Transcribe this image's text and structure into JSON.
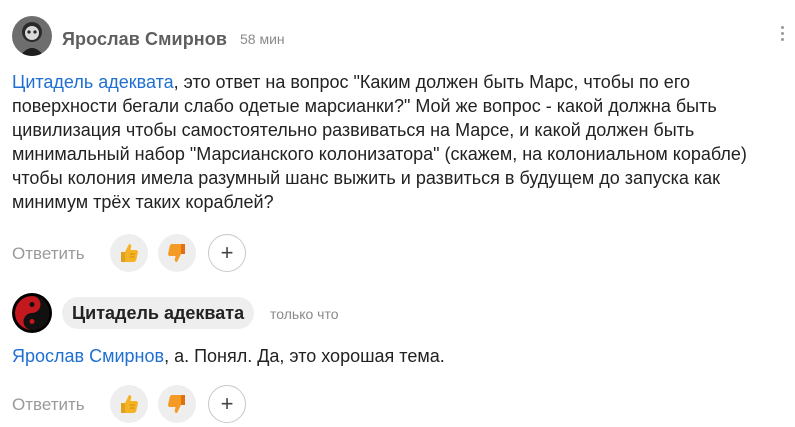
{
  "comments": [
    {
      "author": "Ярослав Смирнов",
      "time": "58 мин",
      "mention": "Цитадель адеквата",
      "text": ", это ответ на вопрос \"Каким должен быть Марс, чтобы по его поверхности бегали слабо одетые марсианки?\" Мой же вопрос - какой должна быть цивилизация чтобы самостоятельно развиваться на Марсе, и какой должен быть минимальный набор \"Марсианского колонизатора\" (скажем, на колониальном корабле) чтобы колония имела разумный шанс выжить и развиться в будущем до запуска как минимум трёх таких кораблей?",
      "reply_label": "Ответить",
      "plus_label": "+"
    },
    {
      "author": "Цитадель адеквата",
      "time": "только что",
      "mention": "Ярослав Смирнов",
      "text": ", а. Понял. Да, это хорошая тема.",
      "reply_label": "Ответить",
      "plus_label": "+"
    }
  ],
  "icons": {
    "like": "thumbs-up-icon",
    "dislike": "thumbs-down-icon",
    "more": "kebab-menu-icon"
  },
  "colors": {
    "link": "#1f6fd2",
    "like_yellow": "#f5b324",
    "pill_bg": "#eeeeee"
  }
}
